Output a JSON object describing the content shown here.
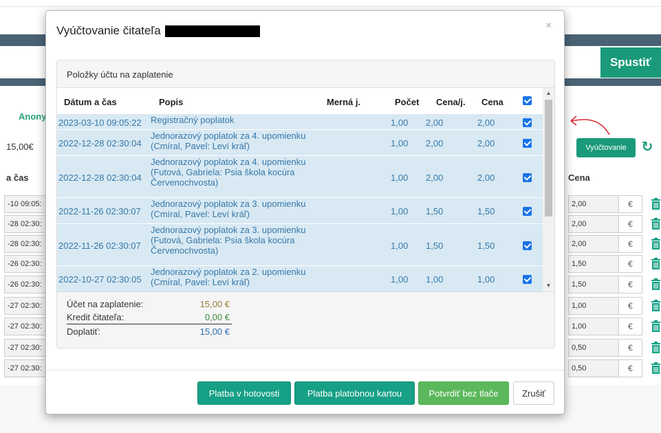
{
  "background": {
    "run_button": "Spustiť",
    "anon_label": "Anony",
    "total_label": "15,00€",
    "left_header": "a čas",
    "right_header": "Cena",
    "account_button": "Vyúčtovanie",
    "left_rows": [
      "-10 09:05:",
      "-28 02:30:",
      "-28 02:30:",
      "-26 02:30:",
      "-26 02:30:",
      "-27 02:30:",
      "-27 02:30:",
      "-27 02:30:",
      "-27 02:30:"
    ],
    "right_rows": [
      "2,00",
      "2,00",
      "2,00",
      "1,50",
      "1,50",
      "1,00",
      "1,00",
      "0,50",
      "0,50"
    ],
    "currency": "€",
    "icons": {
      "refresh": "refresh-icon",
      "trash": "trash-icon",
      "arrow": "arrow-annotation"
    }
  },
  "modal": {
    "title": "Vyúčtovanie čitateľa",
    "close": "×",
    "panel_title": "Položky účtu na zaplatenie",
    "columns": {
      "date": "Dátum a čas",
      "desc": "Popis",
      "unit": "Merná j.",
      "count": "Počet",
      "unit_price": "Cena/j.",
      "price": "Cena"
    },
    "rows": [
      {
        "date": "2023-03-10 09:05:22",
        "desc": "Registračný poplatok",
        "count": "1,00",
        "unit_price": "2,00",
        "price": "2,00",
        "checked": true
      },
      {
        "date": "2022-12-28 02:30:04",
        "desc": "Jednorazový poplatok za 4. upomienku (Cmíral, Pavel: Leví kráľ)",
        "count": "1,00",
        "unit_price": "2,00",
        "price": "2,00",
        "checked": true
      },
      {
        "date": "2022-12-28 02:30:04",
        "desc": "Jednorazový poplatok za 4. upomienku (Futová, Gabriela: Psia škola kocúra Červenochvosta)",
        "count": "1,00",
        "unit_price": "2,00",
        "price": "2,00",
        "checked": true
      },
      {
        "date": "2022-11-26 02:30:07",
        "desc": "Jednorazový poplatok za 3. upomienku (Cmíral, Pavel: Leví kráľ)",
        "count": "1,00",
        "unit_price": "1,50",
        "price": "1,50",
        "checked": true
      },
      {
        "date": "2022-11-26 02:30:07",
        "desc": "Jednorazový poplatok za 3. upomienku (Futová, Gabriela: Psia škola kocúra Červenochvosta)",
        "count": "1,00",
        "unit_price": "1,50",
        "price": "1,50",
        "checked": true
      },
      {
        "date": "2022-10-27 02:30:05",
        "desc": "Jednorazový poplatok za 2. upomienku (Cmíral, Pavel: Leví kráľ)",
        "count": "1,00",
        "unit_price": "1,00",
        "price": "1,00",
        "checked": true
      }
    ],
    "summary": {
      "to_pay_label": "Účet na zaplatenie:",
      "to_pay_value": "15,00 €",
      "credit_label": "Kredit čitateľa:",
      "credit_value": "0,00 €",
      "remaining_label": "Doplatiť:",
      "remaining_value": "15,00 €"
    },
    "buttons": {
      "cash": "Platba v hotovosti",
      "card": "Platba platobnou kartou",
      "confirm": "Potvrdiť bez tlače",
      "cancel": "Zrušiť"
    }
  },
  "colors": {
    "teal": "#16a085",
    "green": "#5cb85c",
    "row_bg": "#d8e9f3",
    "row_text": "#3778a8",
    "checkbox": "#1a73e8",
    "annotation": "#d9262c"
  }
}
